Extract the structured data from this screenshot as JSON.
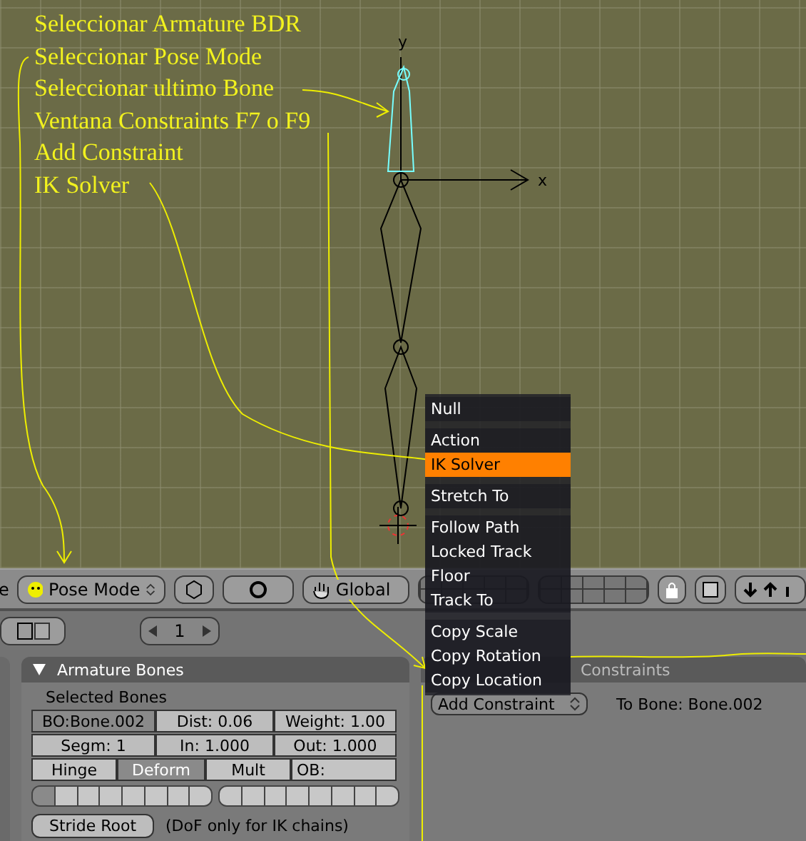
{
  "annotations": [
    "Seleccionar Armature BDR",
    "Seleccionar Pose Mode",
    "Seleccionar ultimo Bone",
    "Ventana Constraints F7 o F9",
    "Add Constraint",
    "IK Solver"
  ],
  "axes": {
    "y": "y",
    "x": "x"
  },
  "menu": {
    "sections": [
      [
        {
          "label": "Null",
          "selected": false
        }
      ],
      [
        {
          "label": "Action",
          "selected": false
        },
        {
          "label": "IK Solver",
          "selected": true
        }
      ],
      [
        {
          "label": "Stretch To",
          "selected": false
        }
      ],
      [
        {
          "label": "Follow Path",
          "selected": false
        },
        {
          "label": "Locked Track",
          "selected": false
        },
        {
          "label": "Floor",
          "selected": false
        },
        {
          "label": "Track To",
          "selected": false
        }
      ],
      [
        {
          "label": "Copy Scale",
          "selected": false
        },
        {
          "label": "Copy Rotation",
          "selected": false
        },
        {
          "label": "Copy Location",
          "selected": false
        }
      ]
    ]
  },
  "toolbar": {
    "cut_label": "e",
    "mode": "Pose Mode",
    "orientation": "Global"
  },
  "subbar": {
    "frame": "1"
  },
  "bones_panel": {
    "title": "Armature Bones",
    "section_label": "Selected Bones",
    "rows": [
      [
        {
          "kind": "name",
          "text": "BO:Bone.002"
        },
        {
          "kind": "number",
          "text": "Dist: 0.06"
        },
        {
          "kind": "number",
          "text": "Weight: 1.00"
        }
      ],
      [
        {
          "kind": "number",
          "text": "Segm: 1"
        },
        {
          "kind": "number",
          "text": "In: 1.000"
        },
        {
          "kind": "number",
          "text": "Out: 1.000"
        }
      ]
    ],
    "toggles": [
      {
        "kind": "toggle",
        "text": "Hinge",
        "selected": false
      },
      {
        "kind": "toggle",
        "text": "Deform",
        "selected": true
      },
      {
        "kind": "toggle",
        "text": "Mult",
        "selected": false
      },
      {
        "kind": "field",
        "text": "OB:"
      }
    ],
    "layers": [
      [
        true,
        false,
        false,
        false,
        false,
        false,
        false,
        false
      ],
      [
        false,
        false,
        false,
        false,
        false,
        false,
        false,
        false
      ]
    ],
    "stride_button": "Stride Root",
    "note": "(DoF only for IK chains)"
  },
  "constraints_panel": {
    "title": "Constraints",
    "add_button": "Add Constraint",
    "to_bone": "To Bone: Bone.002"
  }
}
